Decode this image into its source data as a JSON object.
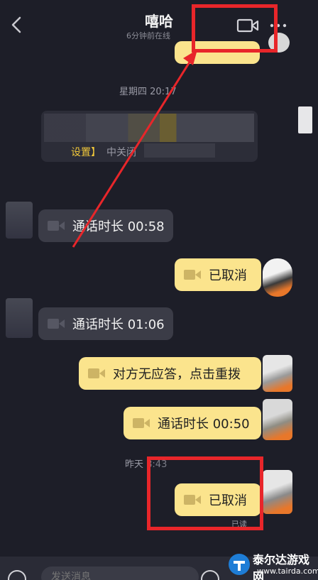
{
  "header": {
    "title": "嘻哈",
    "status": "6分钟前在线"
  },
  "time_divider_1": "星期四 20:17",
  "system_card": {
    "highlight": "设置】",
    "text": "中关闭"
  },
  "messages": [
    {
      "direction": "in",
      "text": "通话时长 00:58"
    },
    {
      "direction": "out",
      "text": "已取消"
    },
    {
      "direction": "in",
      "text": "通话时长 01:06"
    },
    {
      "direction": "out",
      "text": "对方无应答，点击重拨"
    },
    {
      "direction": "out",
      "text": "通话时长 00:50"
    },
    {
      "direction": "out",
      "text": "已取消"
    }
  ],
  "time_divider_2": "昨天 ",
  "time_divider_2_time": "8:43",
  "read_receipt": "已读",
  "input": {
    "placeholder": "发送消息"
  },
  "watermark": {
    "name": "泰尔达游戏网",
    "url": "www.tairda.com"
  },
  "colors": {
    "background": "#1d1e28",
    "incoming_bubble": "#3b3c47",
    "outgoing_bubble": "#fbe48d",
    "annotation_red": "#e8262a"
  },
  "icons": [
    "back-icon",
    "video-call-icon",
    "more-icon",
    "video-camera-icon",
    "voice-icon",
    "emoji-icon"
  ]
}
